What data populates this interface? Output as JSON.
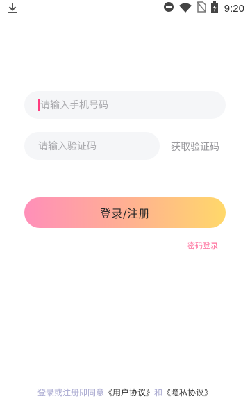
{
  "status_bar": {
    "time": "9:20",
    "icons": [
      "download-icon",
      "do-not-disturb-icon",
      "wifi-icon",
      "no-sim-icon",
      "battery-charging-icon"
    ]
  },
  "form": {
    "phone_placeholder": "请输入手机号码",
    "code_placeholder": "请输入验证码",
    "get_code_label": "获取验证码"
  },
  "buttons": {
    "login_register_label": "登录/注册",
    "password_login_label": "密码登录"
  },
  "agreement": {
    "prefix": "登录或注册即同意",
    "user_agreement": "《用户协议》",
    "connector": "和",
    "privacy_policy": "《隐私协议》"
  },
  "colors": {
    "accent_pink": "#ff6f9c",
    "gradient_start": "#ff8fb9",
    "gradient_end": "#ffd86a",
    "field_bg": "#f5f6f8",
    "caret": "#ff3d7f"
  }
}
